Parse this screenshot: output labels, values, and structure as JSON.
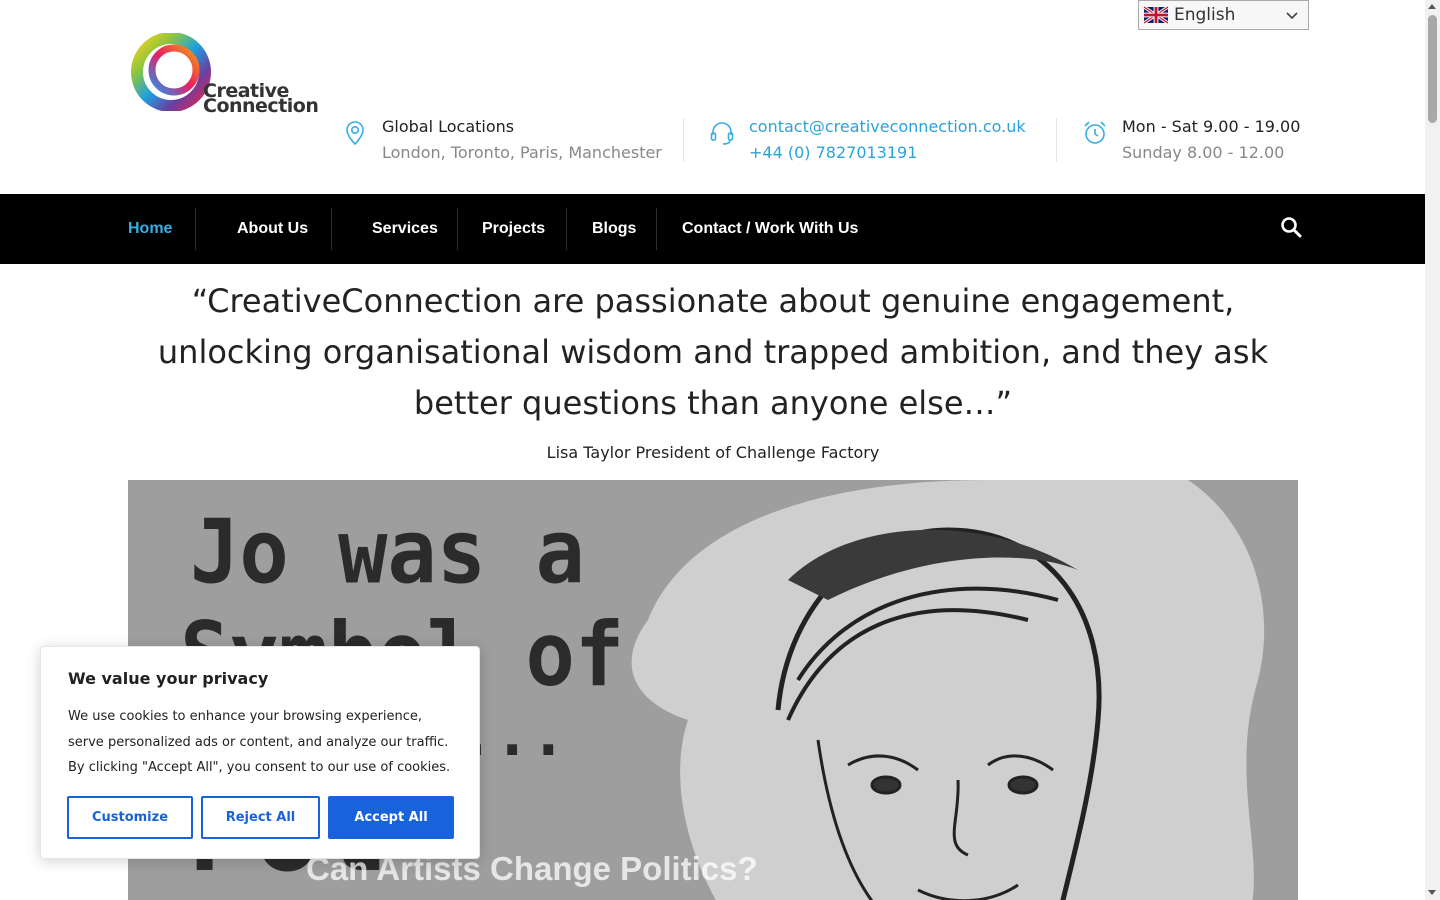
{
  "language_selector": {
    "label": "English",
    "flag_icon": "uk-flag-icon"
  },
  "logo": {
    "line1": "Creative",
    "line2": "Connection"
  },
  "header_info": {
    "locations": {
      "title": "Global Locations",
      "subtitle": "London, Toronto, Paris, Manchester",
      "icon": "map-pin-icon"
    },
    "contact": {
      "email": "contact@creativeconnection.co.uk",
      "phone": "+44 (0) 7827013191",
      "icon": "headset-icon"
    },
    "hours": {
      "title": "Mon - Sat 9.00 - 19.00",
      "subtitle": "Sunday 8.00 - 12.00",
      "icon": "alarm-clock-icon"
    }
  },
  "nav": {
    "items": [
      {
        "label": "Home",
        "active": true
      },
      {
        "label": "About Us"
      },
      {
        "label": "Services"
      },
      {
        "label": "Projects"
      },
      {
        "label": "Blogs"
      },
      {
        "label": "Contact / Work With Us"
      }
    ],
    "search_icon": "search-icon"
  },
  "quote": {
    "text": "“CreativeConnection are passionate about genuine engagement, unlocking organisational wisdom and trapped ambition, and they ask better questions than anyone else…”",
    "author": "Lisa Taylor President of Challenge Factory"
  },
  "hero": {
    "title": "Can Artists Change Politics?",
    "image_text": [
      "Jo was a",
      "Symbol of",
      "...",
      "Pol"
    ]
  },
  "cookie_banner": {
    "title": "We value your privacy",
    "body": "We use cookies to enhance your browsing experience, serve personalized ads or content, and analyze our traffic. By clicking \"Accept All\", you consent to our use of cookies.",
    "customize": "Customize",
    "reject": "Reject All",
    "accept": "Accept All"
  },
  "colors": {
    "accent": "#36aee3",
    "link": "#2aa3d8",
    "nav_bg": "#000000",
    "cookie_primary": "#1863dc"
  }
}
